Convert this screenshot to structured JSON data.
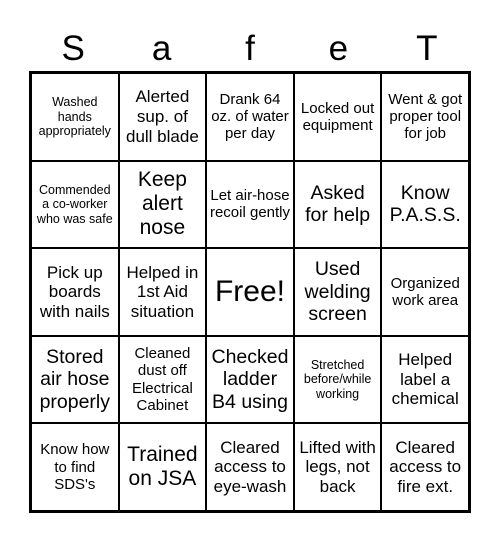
{
  "title": [
    "S",
    "a",
    "f",
    "e",
    "T"
  ],
  "cells": [
    {
      "text": "Washed hands appropriately",
      "size": "s12"
    },
    {
      "text": "Alerted sup. of dull blade",
      "size": "s16"
    },
    {
      "text": "Drank 64 oz. of water per day",
      "size": "s14"
    },
    {
      "text": "Locked out equipment",
      "size": "s14"
    },
    {
      "text": "Went & got proper tool for job",
      "size": "s14"
    },
    {
      "text": "Commended a co-worker who was safe",
      "size": "s12"
    },
    {
      "text": "Keep alert nose",
      "size": "s20"
    },
    {
      "text": "Let air-hose recoil gently",
      "size": "s14"
    },
    {
      "text": "Asked for help",
      "size": "s18"
    },
    {
      "text": "Know P.A.S.S.",
      "size": "s18"
    },
    {
      "text": "Pick up boards with nails",
      "size": "s16"
    },
    {
      "text": "Helped in 1st Aid situation",
      "size": "s16"
    },
    {
      "text": "Free!",
      "size": "s30"
    },
    {
      "text": "Used welding screen",
      "size": "s18"
    },
    {
      "text": "Organized work area",
      "size": "s14"
    },
    {
      "text": "Stored air hose properly",
      "size": "s18"
    },
    {
      "text": "Cleaned dust off Electrical Cabinet",
      "size": "s14"
    },
    {
      "text": "Checked ladder B4 using",
      "size": "s18"
    },
    {
      "text": "Stretched before/while working",
      "size": "s12"
    },
    {
      "text": "Helped label a chemical",
      "size": "s16"
    },
    {
      "text": "Know how to find SDS's",
      "size": "s14"
    },
    {
      "text": "Trained on JSA",
      "size": "s20"
    },
    {
      "text": "Cleared access to eye-wash",
      "size": "s16"
    },
    {
      "text": "Lifted with legs, not back",
      "size": "s16"
    },
    {
      "text": "Cleared access to fire ext.",
      "size": "s16"
    }
  ]
}
